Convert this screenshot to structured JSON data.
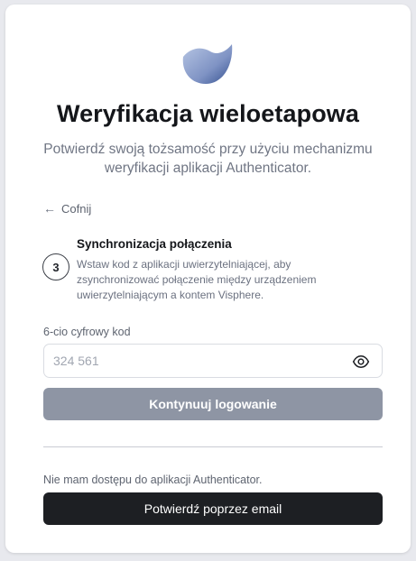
{
  "header": {
    "title": "Weryfikacja wieloetapowa",
    "subtitle": "Potwierdź swoją tożsamość przy użyciu mechanizmu weryfikacji aplikacji Authenticator."
  },
  "nav": {
    "back_label": "Cofnij",
    "back_icon": "arrow-left-icon"
  },
  "step": {
    "number": "3",
    "title": "Synchronizacja połączenia",
    "description": "Wstaw kod z aplikacji uwierzytelniającej, aby zsynchronizować połączenie między urządzeniem uwierzytelniającym a kontem Visphere."
  },
  "code": {
    "label": "6-cio cyfrowy kod",
    "placeholder": "324 561",
    "value": "",
    "toggle_icon": "eye-icon"
  },
  "actions": {
    "continue_label": "Kontynuuj logowanie",
    "no_access_text": "Nie mam dostępu do aplikacji Authenticator.",
    "email_label": "Potwierdź poprzez email"
  },
  "colors": {
    "background": "#e8e9ee",
    "card": "#ffffff",
    "primary_disabled": "#8e95a4",
    "dark_button": "#1d1f23",
    "logo_gradient_start": "#2f4a8a",
    "logo_gradient_end": "#b9c8e6"
  }
}
